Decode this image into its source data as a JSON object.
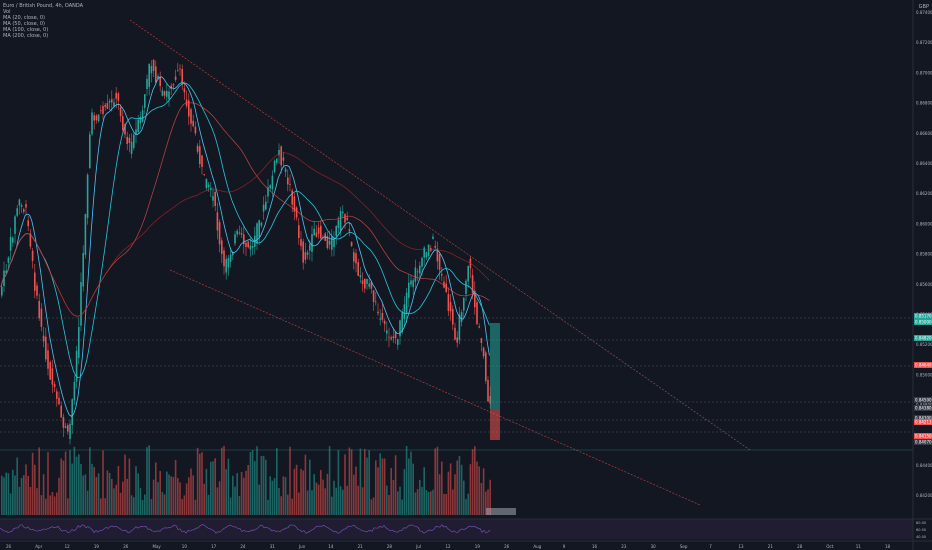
{
  "legend": {
    "symbol": "Euro / British Pound, 4h, OANDA",
    "vol": "Vol",
    "ma1": "MA (20, close, 0)",
    "ma2": "MA (50, close, 0)",
    "ma3": "MA (100, close, 0)",
    "ma4": "MA (200, close, 0)"
  },
  "currency": "GBP",
  "price_axis": [
    "0.87400",
    "0.87200",
    "0.87000",
    "0.86800",
    "0.86600",
    "0.86400",
    "0.86200",
    "0.86000",
    "0.85800",
    "0.85600",
    "0.85400",
    "0.85200",
    "0.85000",
    "0.84800",
    "0.84600",
    "0.84400",
    "0.84200"
  ],
  "price_tags": [
    {
      "label": "0.85170",
      "color": "#26a69a"
    },
    {
      "label": "0.85000",
      "color": "#26a69a"
    },
    {
      "label": "0.84820",
      "color": "#26a69a"
    },
    {
      "label": "0.84649",
      "color": "#ef5350"
    },
    {
      "label": "0.84500",
      "color": "#363a45"
    },
    {
      "label": "0.84380",
      "color": "#363a45"
    },
    {
      "label": "0.84300",
      "color": "#363a45"
    },
    {
      "label": "0.84213",
      "color": "#ef5350"
    },
    {
      "label": "0.84150",
      "color": "#ef5350"
    },
    {
      "label": "0.84070",
      "color": "#363a45"
    }
  ],
  "time_axis": [
    "26",
    "Apr",
    "12",
    "19",
    "26",
    "May",
    "10",
    "17",
    "24",
    "31",
    "Jun",
    "14",
    "21",
    "28",
    "Jul",
    "12",
    "19",
    "26",
    "Aug",
    "9",
    "16",
    "23",
    "30",
    "Sep",
    "7",
    "13",
    "21",
    "28",
    "Oct",
    "11",
    "18"
  ],
  "rsi_axis": [
    "80.00",
    "60.00",
    "40.00"
  ],
  "colors": {
    "up": "#26a69a",
    "down": "#ef5350",
    "bg": "#131722",
    "rsi": "#7e57c2"
  },
  "chart_data": {
    "type": "candlestick",
    "title": "Euro / British Pound, 4h, OANDA",
    "series": [
      {
        "name": "MA (20, close, 0)"
      },
      {
        "name": "MA (50, close, 0)"
      },
      {
        "name": "MA (100, close, 0)"
      },
      {
        "name": "MA (200, close, 0)"
      }
    ],
    "ylim": [
      0.842,
      0.874
    ],
    "grid": false
  }
}
